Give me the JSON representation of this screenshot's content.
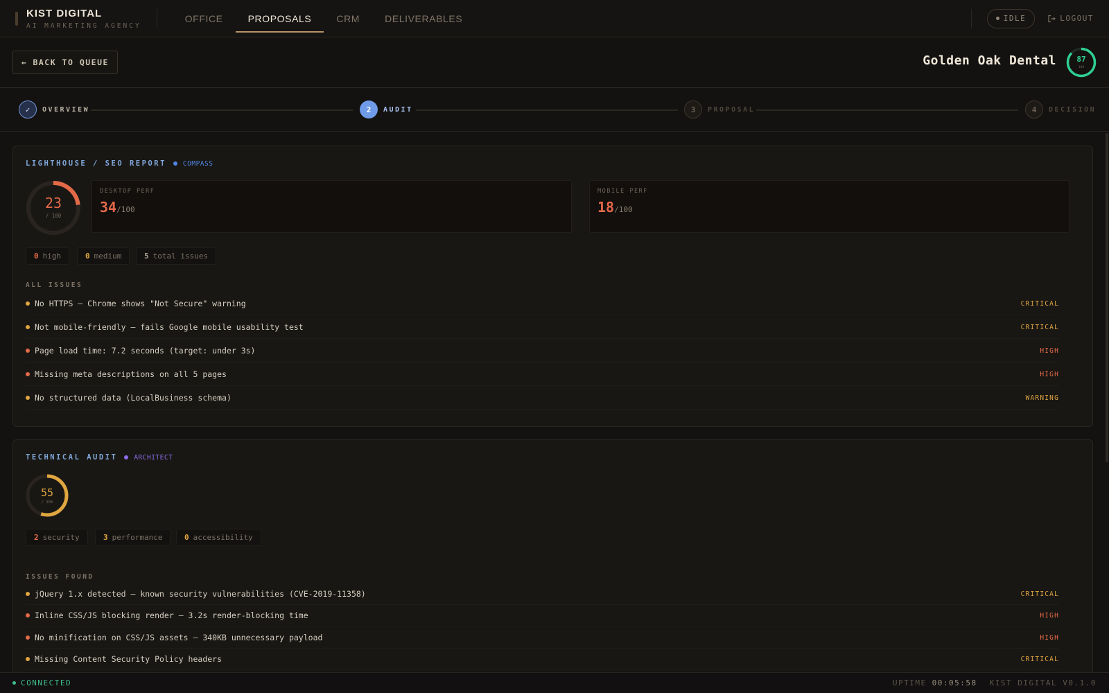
{
  "brand": {
    "name": "KIST DIGITAL",
    "tagline": "AI MARKETING AGENCY"
  },
  "nav": {
    "tabs": [
      {
        "label": "OFFICE",
        "active": false
      },
      {
        "label": "PROPOSALS",
        "active": true
      },
      {
        "label": "CRM",
        "active": false
      },
      {
        "label": "DELIVERABLES",
        "active": false
      }
    ],
    "status_label": "IDLE",
    "logout_label": "LOGOUT"
  },
  "header": {
    "back_label": "BACK TO QUEUE",
    "client_name": "Golden Oak Dental",
    "client_score": {
      "value": "87",
      "max": "100",
      "fraction": 0.87,
      "color": "#2fcf94"
    }
  },
  "stepper": {
    "steps": [
      {
        "num": "✓",
        "label": "OVERVIEW",
        "state": "done"
      },
      {
        "num": "2",
        "label": "AUDIT",
        "state": "active"
      },
      {
        "num": "3",
        "label": "PROPOSAL",
        "state": "pending"
      },
      {
        "num": "4",
        "label": "DECISION",
        "state": "pending"
      }
    ]
  },
  "lighthouse": {
    "title": "LIGHTHOUSE / SEO REPORT",
    "agent": "COMPASS",
    "agent_color": "#4e86e0",
    "score": {
      "value": "23",
      "max": "/ 100",
      "fraction": 0.23,
      "color": "#e36a48"
    },
    "desktop": {
      "label": "DESKTOP PERF",
      "value": "34",
      "suffix": "/100"
    },
    "mobile": {
      "label": "MOBILE PERF",
      "value": "18",
      "suffix": "/100"
    },
    "chips": [
      {
        "n": "0",
        "label": "high",
        "color": "#e36a48"
      },
      {
        "n": "0",
        "label": "medium",
        "color": "#e0a640"
      },
      {
        "n": "5",
        "label": "total issues",
        "color": "#a89f90"
      }
    ],
    "section_label": "ALL ISSUES",
    "issues": [
      {
        "text": "No HTTPS — Chrome shows \"Not Secure\" warning",
        "severity": "CRITICAL",
        "color": "#e0a640"
      },
      {
        "text": "Not mobile-friendly — fails Google mobile usability test",
        "severity": "CRITICAL",
        "color": "#e0a640"
      },
      {
        "text": "Page load time: 7.2 seconds (target: under 3s)",
        "severity": "HIGH",
        "color": "#e36a48"
      },
      {
        "text": "Missing meta descriptions on all 5 pages",
        "severity": "HIGH",
        "color": "#e36a48"
      },
      {
        "text": "No structured data (LocalBusiness schema)",
        "severity": "WARNING",
        "color": "#e0a640"
      }
    ]
  },
  "technical": {
    "title": "TECHNICAL AUDIT",
    "agent": "ARCHITECT",
    "agent_color": "#8a6ee8",
    "score": {
      "value": "55",
      "max": "/ 100",
      "fraction": 0.55,
      "color": "#e0a640"
    },
    "chips": [
      {
        "n": "2",
        "label": "security",
        "color": "#e36a48"
      },
      {
        "n": "3",
        "label": "performance",
        "color": "#e0a640"
      },
      {
        "n": "0",
        "label": "accessibility",
        "color": "#e0a640"
      }
    ],
    "section_label": "ISSUES FOUND",
    "issues": [
      {
        "text": "jQuery 1.x detected — known security vulnerabilities (CVE-2019-11358)",
        "severity": "CRITICAL",
        "color": "#e0a640"
      },
      {
        "text": "Inline CSS/JS blocking render — 3.2s render-blocking time",
        "severity": "HIGH",
        "color": "#e36a48"
      },
      {
        "text": "No minification on CSS/JS assets — 340KB unnecessary payload",
        "severity": "HIGH",
        "color": "#e36a48"
      },
      {
        "text": "Missing Content Security Policy headers",
        "severity": "CRITICAL",
        "color": "#e0a640"
      }
    ]
  },
  "statusbar": {
    "connected_label": "CONNECTED",
    "uptime_label": "UPTIME",
    "uptime_value": "00:05:58",
    "version": "KIST DIGITAL V0.1.0"
  }
}
